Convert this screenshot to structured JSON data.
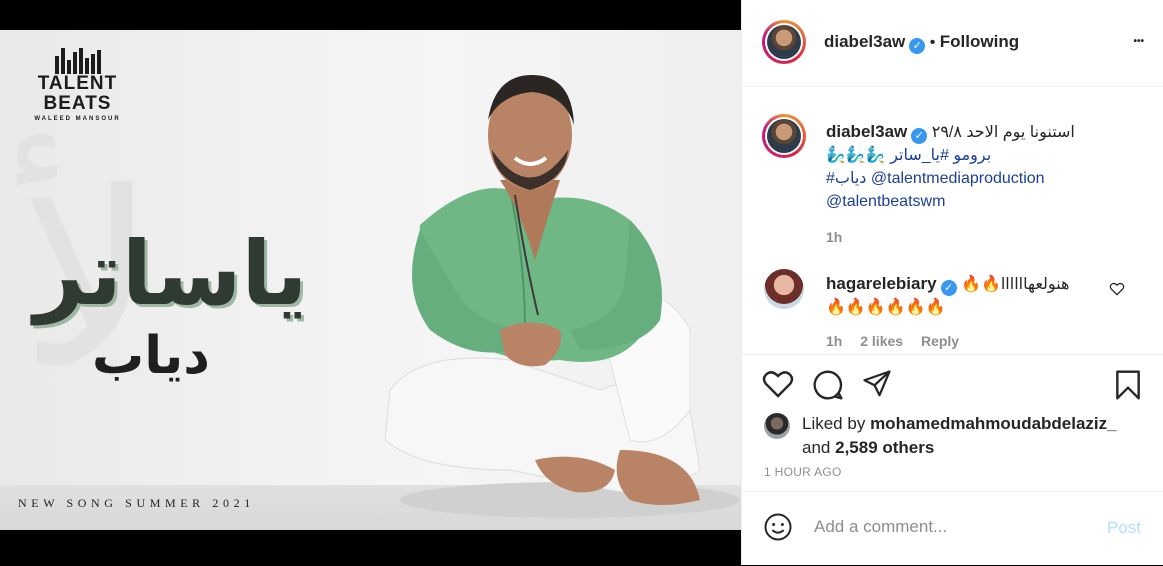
{
  "media": {
    "logo": {
      "line1": "TALENT",
      "line2": "BEATS",
      "line3": "WALEED MANSOUR"
    },
    "title_ar": "ياساتر",
    "subtitle_ar": "دياب",
    "tagline": "NEW SONG SUMMER 2021"
  },
  "header": {
    "username": "diabel3aw",
    "verified": "✓",
    "separator": "•",
    "follow_status": "Following",
    "more": "•••"
  },
  "caption": {
    "username": "diabel3aw",
    "line1": "استنونا يوم الاحد ٢٩/٨",
    "line2": "برومو #يا_ساتر 🧞‍♂️🧞‍♂️🧞‍♂️",
    "line3_hashtag": "#دياب",
    "line3_mention": "@talentmediaproduction",
    "line4_mention": "@talentbeatswm",
    "time": "1h"
  },
  "comment": {
    "username": "hagarelebiary",
    "text_line1": "هنولعهاااااا🔥🔥",
    "text_line2": "🔥🔥🔥🔥🔥🔥",
    "time": "1h",
    "likes": "2 likes",
    "reply": "Reply"
  },
  "likes": {
    "prefix": "Liked by",
    "user": "mohamedmahmoudabdelaziz_",
    "and": "and",
    "others": "2,589 others"
  },
  "timestamp": "1 HOUR AGO",
  "add_comment": {
    "placeholder": "Add a comment...",
    "post_label": "Post"
  },
  "colors": {
    "verified": "#3897f0",
    "link": "#1b3f9a",
    "post_disabled": "#b2dffc"
  }
}
